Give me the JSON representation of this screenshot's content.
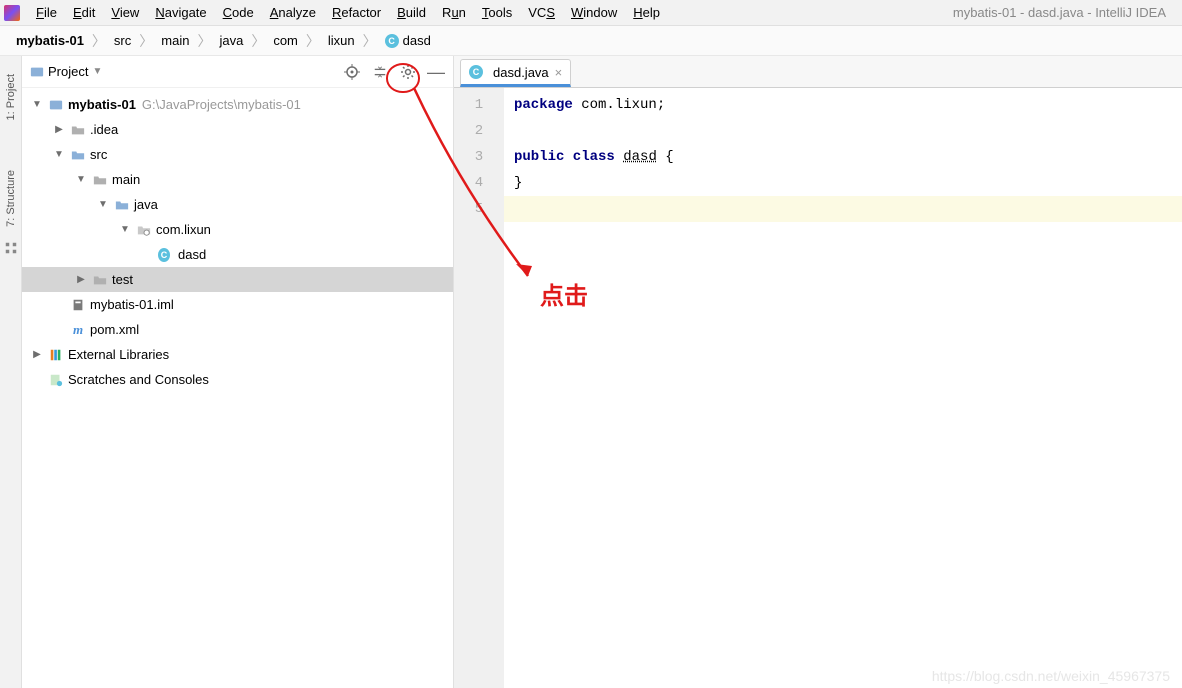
{
  "menu": {
    "items": [
      {
        "u": "F",
        "rest": "ile"
      },
      {
        "u": "E",
        "rest": "dit"
      },
      {
        "u": "V",
        "rest": "iew"
      },
      {
        "u": "N",
        "rest": "avigate"
      },
      {
        "u": "C",
        "rest": "ode"
      },
      {
        "u": "",
        "rest": "Analyze",
        "plain": true,
        "underlineIndex": 0
      },
      {
        "u": "R",
        "rest": "efactor"
      },
      {
        "u": "B",
        "rest": "uild"
      },
      {
        "u": "",
        "rest": "Run",
        "underline": "u"
      },
      {
        "u": "T",
        "rest": "ools"
      },
      {
        "u": "",
        "rest": "VCS",
        "underline": "S"
      },
      {
        "u": "W",
        "rest": "indow"
      },
      {
        "u": "H",
        "rest": "elp"
      }
    ],
    "windowTitle": "mybatis-01 - dasd.java - IntelliJ IDEA"
  },
  "breadcrumb": {
    "items": [
      "mybatis-01",
      "src",
      "main",
      "java",
      "com",
      "lixun",
      "dasd"
    ]
  },
  "projectPanel": {
    "title": "Project",
    "tree": [
      {
        "depth": 0,
        "arrow": "▼",
        "icon": "module",
        "label": "mybatis-01",
        "bold": true,
        "path": "G:\\JavaProjects\\mybatis-01"
      },
      {
        "depth": 1,
        "arrow": "▶",
        "icon": "folder",
        "label": ".idea"
      },
      {
        "depth": 1,
        "arrow": "▼",
        "icon": "folder-src",
        "label": "src"
      },
      {
        "depth": 2,
        "arrow": "▼",
        "icon": "folder",
        "label": "main"
      },
      {
        "depth": 3,
        "arrow": "▼",
        "icon": "folder-src",
        "label": "java"
      },
      {
        "depth": 4,
        "arrow": "▼",
        "icon": "package",
        "label": "com.lixun"
      },
      {
        "depth": 5,
        "arrow": "",
        "icon": "class",
        "label": "dasd"
      },
      {
        "depth": 2,
        "arrow": "▶",
        "icon": "folder",
        "label": "test",
        "selected": true
      },
      {
        "depth": 1,
        "arrow": "",
        "icon": "iml",
        "label": "mybatis-01.iml"
      },
      {
        "depth": 1,
        "arrow": "",
        "icon": "maven",
        "label": "pom.xml"
      },
      {
        "depth": 0,
        "arrow": "▶",
        "icon": "libs",
        "label": "External Libraries"
      },
      {
        "depth": 0,
        "arrow": "",
        "icon": "scratch",
        "label": "Scratches and Consoles"
      }
    ]
  },
  "sideTabs": {
    "project": "1: Project",
    "structure": "7: Structure"
  },
  "editor": {
    "tabName": "dasd.java",
    "lines": [
      {
        "n": "1",
        "html": "<span class='kw'>package</span> com.lixun;"
      },
      {
        "n": "2",
        "html": ""
      },
      {
        "n": "3",
        "html": "<span class='kw'>public class</span> <span class='cls'>dasd</span> {"
      },
      {
        "n": "4",
        "html": "}"
      },
      {
        "n": "5",
        "html": ""
      }
    ]
  },
  "annotation": {
    "text": "点击"
  },
  "watermark": "https://blog.csdn.net/weixin_45967375"
}
